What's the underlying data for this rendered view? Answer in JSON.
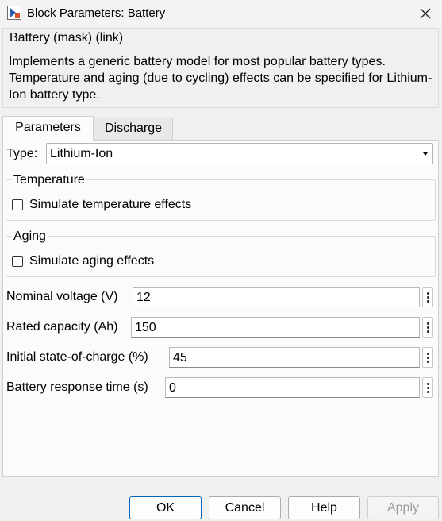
{
  "window": {
    "title": "Block Parameters: Battery"
  },
  "description": {
    "title": "Battery (mask) (link)",
    "text": "Implements a generic battery model for most popular battery types. Temperature and aging (due to cycling) effects can be specified for Lithium-Ion battery type."
  },
  "tabs": [
    {
      "label": "Parameters",
      "active": true
    },
    {
      "label": "Discharge",
      "active": false
    }
  ],
  "type_field": {
    "label": "Type:",
    "value": "Lithium-Ion"
  },
  "temperature": {
    "group_title": "Temperature",
    "checkbox_label": "Simulate temperature effects",
    "checked": false
  },
  "aging": {
    "group_title": "Aging",
    "checkbox_label": "Simulate aging effects",
    "checked": false
  },
  "params": [
    {
      "label": "Nominal voltage (V)",
      "value": "12"
    },
    {
      "label": "Rated capacity (Ah)",
      "value": "150"
    },
    {
      "label": "Initial state-of-charge (%)",
      "value": "45"
    },
    {
      "label": "Battery response time (s)",
      "value": "0"
    }
  ],
  "buttons": {
    "ok": "OK",
    "cancel": "Cancel",
    "help": "Help",
    "apply": "Apply"
  },
  "icons": {
    "app": "simulink-block-icon",
    "close": "close-icon",
    "dropdown": "chevron-down-icon",
    "param_menu": "kebab-menu-icon"
  },
  "colors": {
    "background": "#f0f0f0",
    "panel": "#fbfbfb",
    "default_button_border": "#0067c0"
  }
}
